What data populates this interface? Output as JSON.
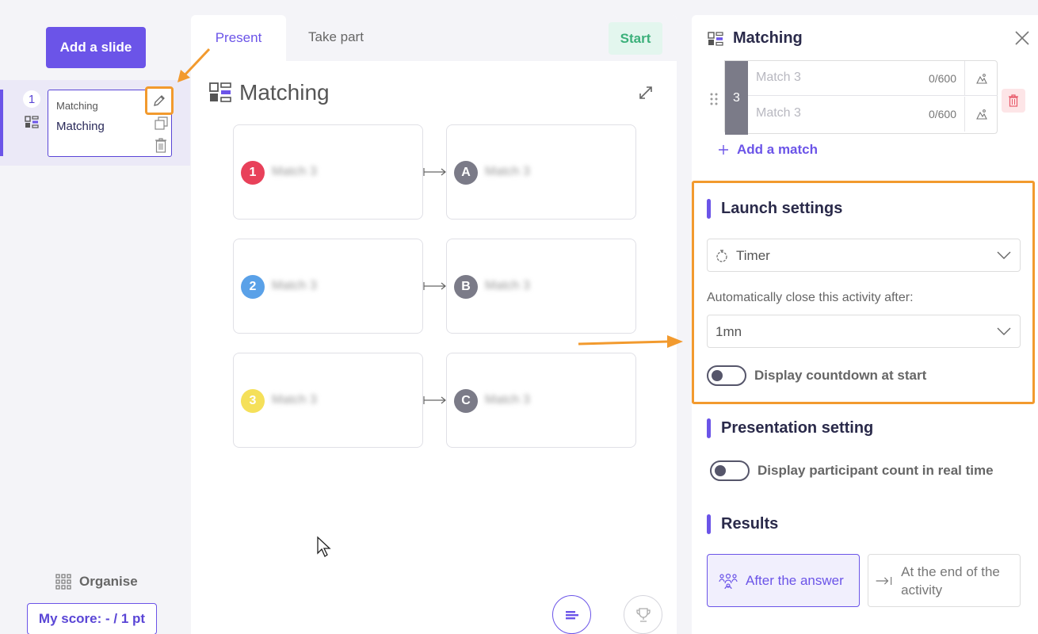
{
  "sidebar": {
    "add_slide_label": "Add a slide",
    "slide": {
      "number": "1",
      "type_label": "Matching",
      "title": "Matching"
    },
    "organise_label": "Organise",
    "score_label": "My score: - / 1 pt"
  },
  "center": {
    "tabs": [
      {
        "label": "Present"
      },
      {
        "label": "Take part"
      }
    ],
    "start_label": "Start",
    "title": "Matching",
    "pairs": [
      {
        "left_badge": "1",
        "left_color": "#e8415a",
        "left_text": "Match 3",
        "right_badge": "A",
        "right_text": "Match 3"
      },
      {
        "left_badge": "2",
        "left_color": "#5aa1e8",
        "left_text": "Match 3",
        "right_badge": "B",
        "right_text": "Match 3"
      },
      {
        "left_badge": "3",
        "left_color": "#f5e05a",
        "left_text": "Match 3",
        "right_badge": "C",
        "right_text": "Match 3"
      }
    ]
  },
  "panel": {
    "title": "Matching",
    "match_row": {
      "number": "3",
      "line1_placeholder": "Match 3",
      "line1_count": "0/600",
      "line2_placeholder": "Match 3",
      "line2_count": "0/600"
    },
    "add_match_label": "Add a match",
    "launch": {
      "title": "Launch settings",
      "mode_value": "Timer",
      "auto_close_label": "Automatically close this activity after:",
      "duration_value": "1mn",
      "countdown_label": "Display countdown at start"
    },
    "presentation": {
      "title": "Presentation setting",
      "participant_label": "Display participant count in real time"
    },
    "results": {
      "title": "Results",
      "after_answer_label": "After the answer",
      "end_activity_label": "At the end of the activity"
    }
  },
  "colors": {
    "accent": "#6b54e8",
    "start_green": "#3bb07a",
    "highlight_orange": "#f29a2e",
    "badge_gray": "#7b7b88"
  }
}
